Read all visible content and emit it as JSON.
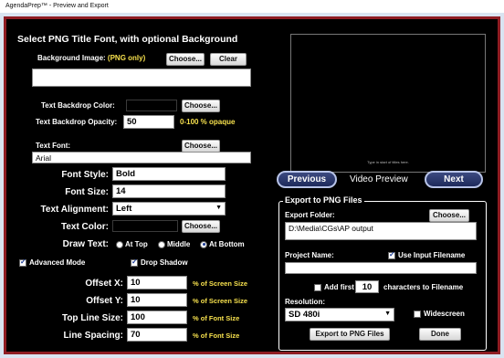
{
  "window": {
    "title": "AgendaPrep™ - Preview and Export"
  },
  "left": {
    "heading": "Select PNG Title Font, with optional Background",
    "background_image": {
      "label": "Background Image:",
      "note": "(PNG only)",
      "choose_label": "Choose...",
      "clear_label": "Clear",
      "value": ""
    },
    "backdrop_color": {
      "label": "Text Backdrop Color:",
      "choose_label": "Choose...",
      "color": "#000000"
    },
    "backdrop_opacity": {
      "label": "Text Backdrop Opacity:",
      "value": "50",
      "hint": "0-100 % opaque"
    },
    "text_font": {
      "label": "Text Font:",
      "choose_label": "Choose...",
      "value": "Arial"
    },
    "font_style": {
      "label": "Font Style:",
      "value": "Bold"
    },
    "font_size": {
      "label": "Font Size:",
      "value": "14"
    },
    "text_alignment": {
      "label": "Text Alignment:",
      "value": "Left"
    },
    "text_color": {
      "label": "Text Color:",
      "choose_label": "Choose...",
      "color": "#000000"
    },
    "draw_text": {
      "label": "Draw Text:",
      "options": [
        "At Top",
        "Middle",
        "At Bottom"
      ],
      "selected": "At Bottom"
    },
    "advanced_mode": {
      "label": "Advanced Mode",
      "checked": true
    },
    "drop_shadow": {
      "label": "Drop Shadow",
      "checked": true
    },
    "offset_x": {
      "label": "Offset X:",
      "value": "10",
      "unit": "% of Screen Size"
    },
    "offset_y": {
      "label": "Offset Y:",
      "value": "10",
      "unit": "% of Screen Size"
    },
    "top_line_size": {
      "label": "Top Line Size:",
      "value": "100",
      "unit": "% of Font Size"
    },
    "line_spacing": {
      "label": "Line Spacing:",
      "value": "70",
      "unit": "% of Font Size"
    }
  },
  "preview": {
    "placeholder_text": "Type in start of titles here.",
    "previous_label": "Previous",
    "caption": "Video Preview",
    "next_label": "Next"
  },
  "export": {
    "group_title": "Export to PNG Files",
    "folder_label": "Export Folder:",
    "folder_choose_label": "Choose...",
    "folder_value": "D:\\Media\\CGs\\AP output",
    "project_label": "Project Name:",
    "use_input_filename": {
      "label": "Use Input Filename",
      "checked": true
    },
    "project_value": "",
    "add_first": {
      "label": "Add first",
      "value": "10",
      "suffix": "characters to Filename",
      "checked": false
    },
    "resolution_label": "Resolution:",
    "resolution_value": "SD 480i",
    "widescreen": {
      "label": "Widescreen",
      "checked": false
    },
    "export_button_label": "Export to PNG Files",
    "done_button_label": "Done"
  }
}
